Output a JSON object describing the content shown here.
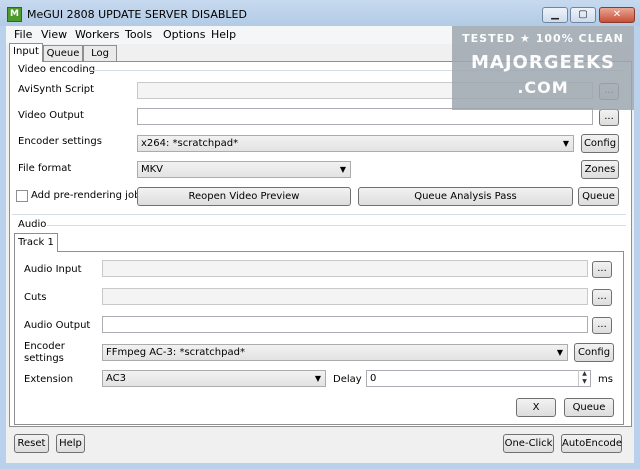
{
  "window": {
    "title": "MeGUI 2808 UPDATE SERVER DISABLED",
    "icon_label": "M",
    "min": "▁",
    "max": "▢",
    "close": "✕"
  },
  "menu": [
    "File",
    "View",
    "Workers",
    "Tools",
    "Options",
    "Help"
  ],
  "tabs": [
    {
      "label": "Input",
      "active": true
    },
    {
      "label": "Queue",
      "active": false
    },
    {
      "label": "Log",
      "active": false
    }
  ],
  "video": {
    "group_label": "Video encoding",
    "avisynth_label": "AviSynth Script",
    "avisynth_value": "",
    "output_label": "Video Output",
    "output_value": "",
    "encoder_label": "Encoder settings",
    "encoder_value": "x264: *scratchpad*",
    "format_label": "File format",
    "format_value": "MKV",
    "config_button": "Config",
    "zones_button": "Zones",
    "prerender_label": "Add pre-rendering job",
    "prerender_checked": false,
    "reopen_button": "Reopen Video Preview",
    "analysis_button": "Queue Analysis Pass",
    "queue_button": "Queue"
  },
  "audio": {
    "group_label": "Audio",
    "track_tab": "Track 1",
    "input_label": "Audio Input",
    "input_value": "",
    "cuts_label": "Cuts",
    "cuts_value": "",
    "output_label": "Audio Output",
    "output_value": "",
    "encoder_label_line1": "Encoder",
    "encoder_label_line2": "settings",
    "encoder_value": "FFmpeg AC-3: *scratchpad*",
    "config_button": "Config",
    "extension_label": "Extension",
    "extension_value": "AC3",
    "delay_label": "Delay",
    "delay_value": "0",
    "delay_unit": "ms",
    "x_button": "X",
    "queue_button": "Queue"
  },
  "browse_label": "...",
  "footer": {
    "reset": "Reset",
    "help": "Help",
    "one_click": "One-Click",
    "auto_encode": "AutoEncode"
  },
  "watermark": {
    "line1": "TESTED ★ 100% CLEAN",
    "line2": "MAJORGEEKS",
    "line3": ".COM"
  }
}
